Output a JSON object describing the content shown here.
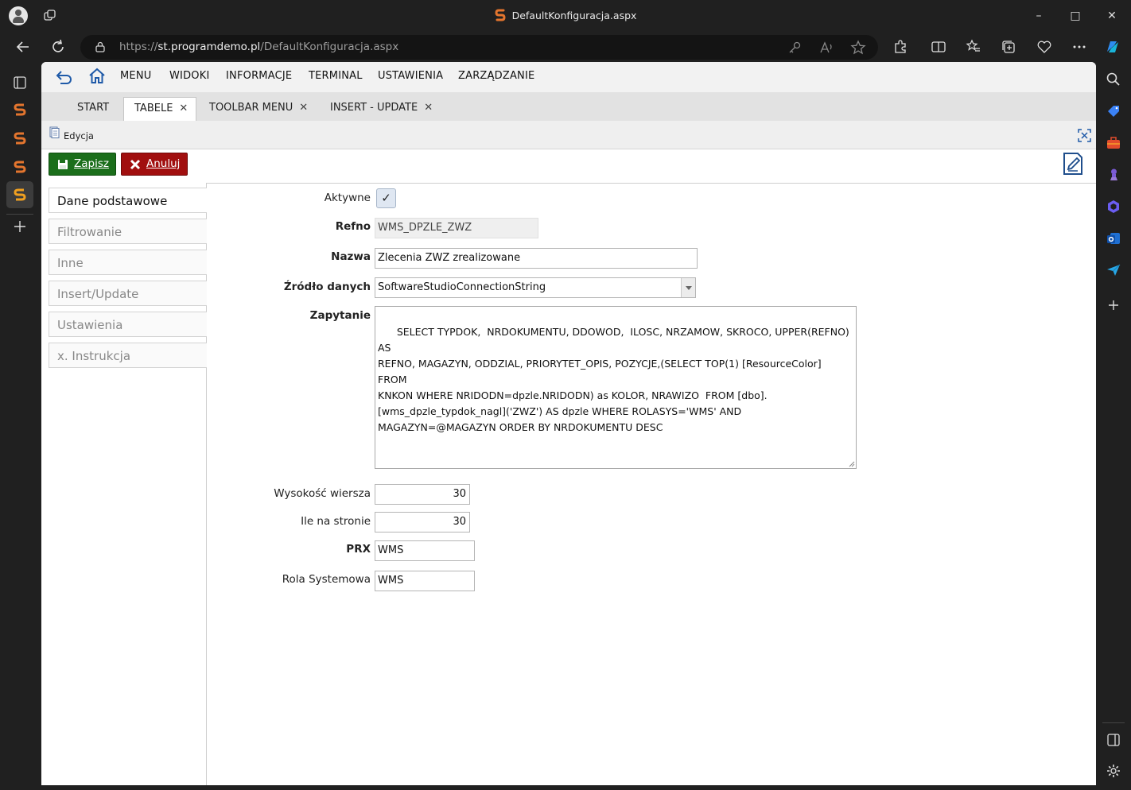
{
  "browser": {
    "window_title": "DefaultKonfiguracja.aspx",
    "url_prefix": "https://",
    "url_host": "st.programdemo.pl",
    "url_path": "/DefaultKonfiguracja.aspx",
    "window_buttons": {
      "minimize": "–",
      "maximize": "□",
      "close": "✕"
    },
    "accent_color": "#e3752e"
  },
  "menu": {
    "items": [
      "MENU",
      "WIDOKI",
      "INFORMACJE",
      "TERMINAL",
      "USTAWIENIA",
      "ZARZĄDZANIE"
    ]
  },
  "tabs": [
    {
      "label": "START",
      "closable": false
    },
    {
      "label": "TABELE",
      "closable": true,
      "active": true
    },
    {
      "label": "TOOLBAR MENU",
      "closable": true
    },
    {
      "label": "INSERT - UPDATE",
      "closable": true
    }
  ],
  "tab_close_glyph": "✕",
  "panel": {
    "title": "Edycja"
  },
  "toolbar": {
    "save_label": "Zapisz",
    "cancel_label": "Anuluj",
    "save_color": "#1b6e1b",
    "cancel_color": "#a10f0f"
  },
  "side_tabs": [
    "Dane podstawowe",
    "Filtrowanie",
    "Inne",
    "Insert/Update",
    "Ustawienia",
    "x. Instrukcja"
  ],
  "form": {
    "aktywne": {
      "label": "Aktywne",
      "checked": true,
      "mark": "✓"
    },
    "refno": {
      "label": "Refno",
      "value": "WMS_DPZLE_ZWZ"
    },
    "nazwa": {
      "label": "Nazwa",
      "value": "Zlecenia ZWZ zrealizowane"
    },
    "zrodlo": {
      "label": "Źródło danych",
      "value": "SoftwareStudioConnectionString"
    },
    "zapytanie": {
      "label": "Zapytanie",
      "value": "SELECT TYPDOK,  NRDOKUMENTU, DDOWOD,  ILOSC, NRZAMOW, SKROCO, UPPER(REFNO) AS\nREFNO, MAGAZYN, ODDZIAL, PRIORYTET_OPIS, POZYCJE,(SELECT TOP(1) [ResourceColor] FROM\nKNKON WHERE NRIDODN=dpzle.NRIDODN) as KOLOR, NRAWIZO  FROM [dbo].\n[wms_dpzle_typdok_nagl]('ZWZ') AS dpzle WHERE ROLASYS='WMS' AND\nMAGAZYN=@MAGAZYN ORDER BY NRDOKUMENTU DESC"
    },
    "wysokosc": {
      "label": "Wysokość wiersza",
      "value": "30"
    },
    "ile": {
      "label": "Ile na stronie",
      "value": "30"
    },
    "prx": {
      "label": "PRX",
      "value": "WMS"
    },
    "rola": {
      "label": "Rola Systemowa",
      "value": "WMS"
    }
  }
}
